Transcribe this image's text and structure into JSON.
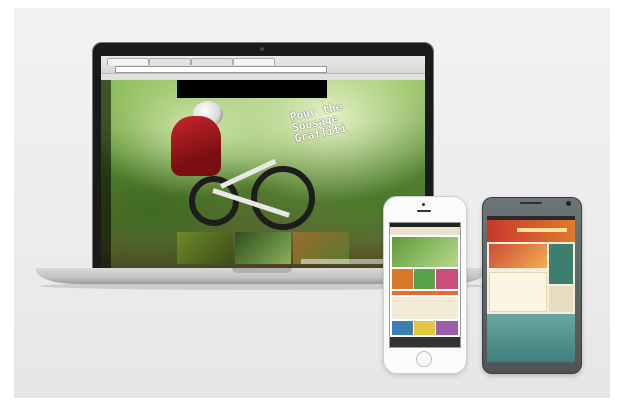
{
  "scene": {
    "description_devices": [
      "laptop",
      "iphone",
      "android-phone"
    ]
  },
  "laptop": {
    "hero_heading": "Pour the\nSousage\nGraffiti",
    "thumb_colors": [
      "#7a8b3a",
      "#2f4f1f",
      "#9a6b2e",
      "#5c7a3e"
    ]
  },
  "iphone": {
    "header_color": "#e86b2a",
    "tiles": [
      "#d9772a",
      "#5aa24b",
      "#c84f7b",
      "#3c7fb6",
      "#e4c43e",
      "#9b5ea8"
    ]
  },
  "android": {
    "header_color": "#c9382c",
    "band_color": "#6aa6a3"
  }
}
